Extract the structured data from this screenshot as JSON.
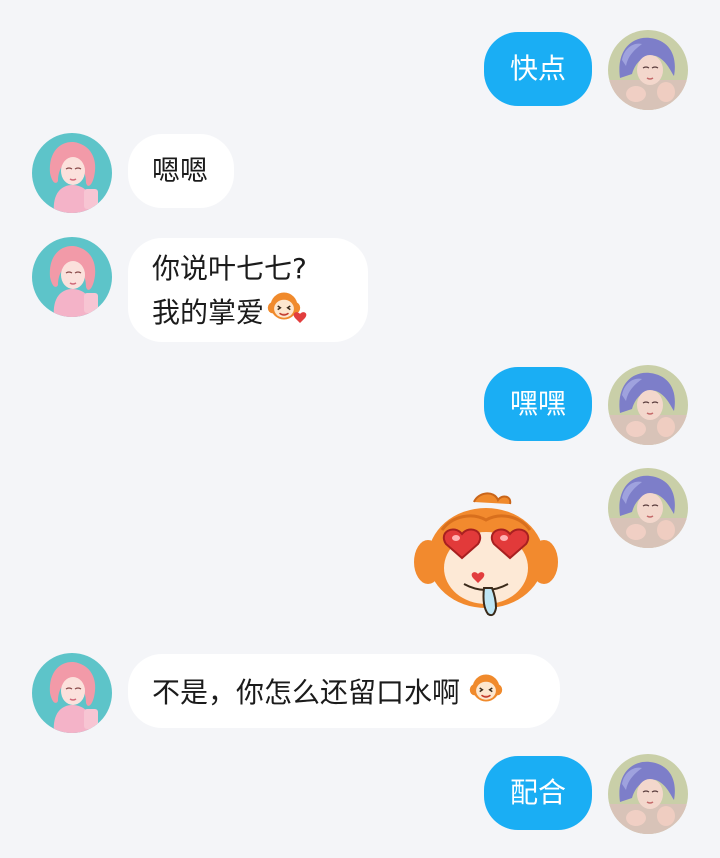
{
  "messages": [
    {
      "side": "out",
      "text": "快点"
    },
    {
      "side": "in",
      "text": "嗯嗯"
    },
    {
      "side": "in",
      "line1": "你说叶七七?",
      "line2": "我的掌爱",
      "emoji": "shy-monkey-emoji"
    },
    {
      "side": "out",
      "text": "嘿嘿"
    },
    {
      "side": "out",
      "sticker": "heart-eyes-drooling-monkey-sticker"
    },
    {
      "side": "in",
      "text": "不是，你怎么还留口水啊",
      "emoji": "laughing-monkey-emoji"
    },
    {
      "side": "out",
      "text": "配合"
    }
  ],
  "colors": {
    "background": "#f4f5f8",
    "outgoing_bubble": "#1aaef4",
    "incoming_bubble": "#ffffff"
  }
}
